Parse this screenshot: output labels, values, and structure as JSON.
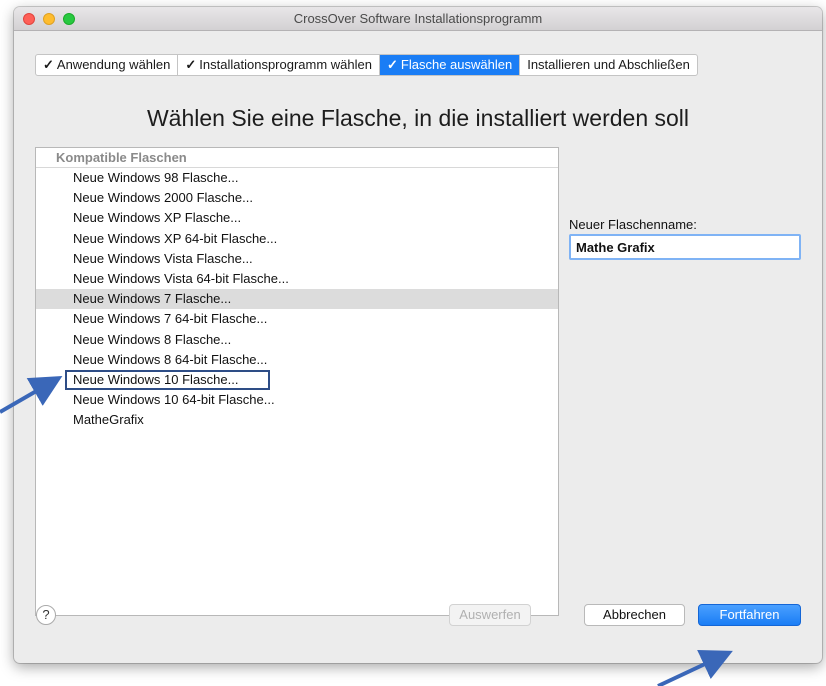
{
  "window": {
    "title": "CrossOver Software Installationsprogramm"
  },
  "steps": [
    {
      "label": "Anwendung wählen",
      "check": "✓"
    },
    {
      "label": "Installationsprogramm wählen",
      "check": "✓"
    },
    {
      "label": "Flasche auswählen",
      "check": "✓"
    },
    {
      "label": "Installieren und Abschließen",
      "check": ""
    }
  ],
  "heading": "Wählen Sie eine Flasche, in die installiert werden soll",
  "bottle_list": {
    "header": "Kompatible Flaschen",
    "items": [
      "Neue Windows 98 Flasche...",
      "Neue Windows 2000 Flasche...",
      "Neue Windows XP Flasche...",
      "Neue Windows XP 64-bit Flasche...",
      "Neue Windows Vista Flasche...",
      "Neue Windows Vista 64-bit Flasche...",
      "Neue Windows 7 Flasche...",
      "Neue Windows 7 64-bit Flasche...",
      "Neue Windows 8 Flasche...",
      "Neue Windows 8 64-bit Flasche...",
      "Neue Windows 10 Flasche...",
      "Neue Windows 10 64-bit Flasche...",
      "MatheGrafix"
    ],
    "selected_item": "Neue Windows 7 Flasche...",
    "highlighted_item": "Neue Windows 10 Flasche..."
  },
  "bottle_name": {
    "label": "Neuer Flaschenname:",
    "value": "Mathe Grafix"
  },
  "footer": {
    "help_label": "?",
    "eject_label": "Auswerfen",
    "cancel_label": "Abbrechen",
    "continue_label": "Fortfahren"
  },
  "colors": {
    "accent": "#1a7df5",
    "annotation_arrow": "#3a67b8",
    "annotation_box": "#2e4d86"
  }
}
